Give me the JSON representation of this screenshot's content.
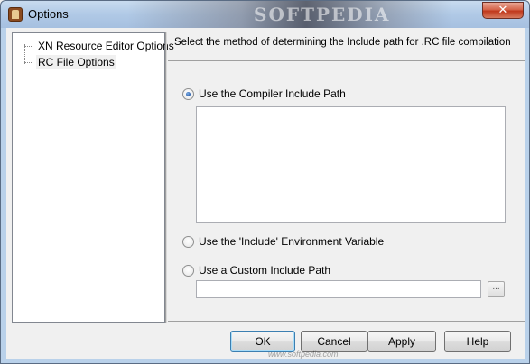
{
  "window": {
    "title": "Options",
    "title_watermark": "SOFTPEDIA",
    "close_label": "✕"
  },
  "tree": {
    "items": [
      {
        "label": "XN Resource Editor Options",
        "selected": false
      },
      {
        "label": "RC File Options",
        "selected": true
      }
    ]
  },
  "panel": {
    "description": "Select the method of determining the Include path for .RC file compilation",
    "options": [
      {
        "label": "Use the Compiler Include Path",
        "checked": true
      },
      {
        "label": "Use the 'Include' Environment Variable",
        "checked": false
      },
      {
        "label": "Use a Custom Include Path",
        "checked": false
      }
    ],
    "custom_path_value": "",
    "browse_label": "..."
  },
  "buttons": {
    "ok": "OK",
    "cancel": "Cancel",
    "apply": "Apply",
    "help": "Help"
  },
  "footer_watermark": "www.softpedia.com",
  "colors": {
    "titlebar": "#b0c9e6",
    "close_button": "#c0381c",
    "radio_dot": "#2a5da8"
  }
}
